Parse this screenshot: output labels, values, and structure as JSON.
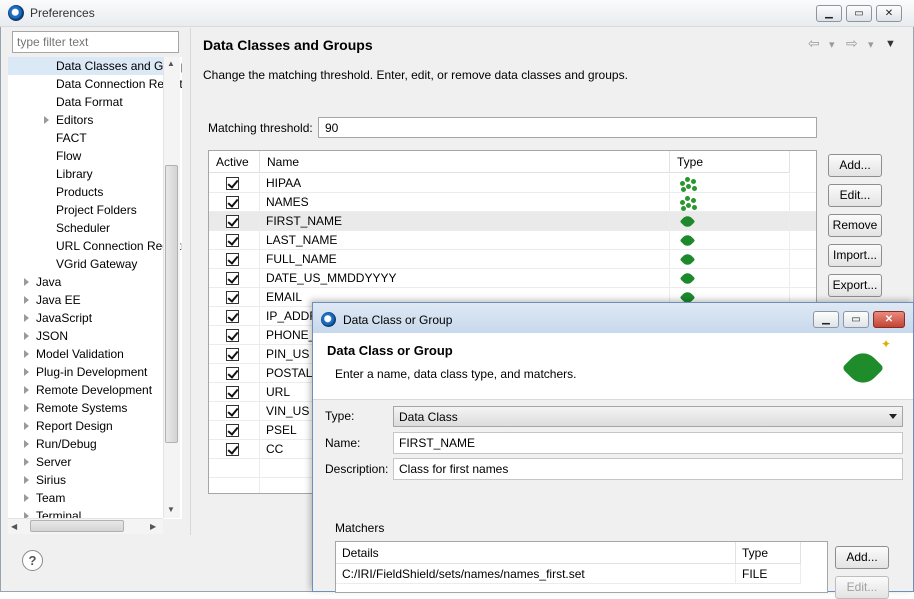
{
  "window": {
    "title": "Preferences",
    "controls": [
      "▁",
      "▭",
      "✕"
    ]
  },
  "filter": {
    "placeholder": "type filter text"
  },
  "tree": {
    "items": [
      {
        "label": "Data Classes and Groups",
        "selected": true,
        "twisty": ""
      },
      {
        "label": "Data Connection Registry",
        "twisty": ""
      },
      {
        "label": "Data Format",
        "twisty": ""
      },
      {
        "label": "Editors",
        "twisty": "hollow"
      },
      {
        "label": "FACT",
        "twisty": ""
      },
      {
        "label": "Flow",
        "twisty": ""
      },
      {
        "label": "Library",
        "twisty": ""
      },
      {
        "label": "Products",
        "twisty": ""
      },
      {
        "label": "Project Folders",
        "twisty": ""
      },
      {
        "label": "Scheduler",
        "twisty": ""
      },
      {
        "label": "URL Connection Registry",
        "twisty": ""
      },
      {
        "label": "VGrid Gateway",
        "twisty": ""
      },
      {
        "label": "Java",
        "twisty": "hollow",
        "top": true
      },
      {
        "label": "Java EE",
        "twisty": "hollow",
        "top": true
      },
      {
        "label": "JavaScript",
        "twisty": "hollow",
        "top": true
      },
      {
        "label": "JSON",
        "twisty": "hollow",
        "top": true
      },
      {
        "label": "Model Validation",
        "twisty": "hollow",
        "top": true
      },
      {
        "label": "Plug-in Development",
        "twisty": "hollow",
        "top": true
      },
      {
        "label": "Remote Development",
        "twisty": "hollow",
        "top": true
      },
      {
        "label": "Remote Systems",
        "twisty": "hollow",
        "top": true
      },
      {
        "label": "Report Design",
        "twisty": "hollow",
        "top": true
      },
      {
        "label": "Run/Debug",
        "twisty": "hollow",
        "top": true
      },
      {
        "label": "Server",
        "twisty": "hollow",
        "top": true
      },
      {
        "label": "Sirius",
        "twisty": "hollow",
        "top": true
      },
      {
        "label": "Team",
        "twisty": "hollow",
        "top": true
      },
      {
        "label": "Terminal",
        "twisty": "hollow",
        "top": true
      }
    ]
  },
  "help": {
    "label": "?"
  },
  "page": {
    "title": "Data Classes and Groups",
    "description": "Change the matching threshold. Enter, edit, or remove data classes and groups.",
    "threshold_label": "Matching threshold:",
    "threshold_value": "90",
    "nav": {
      "back": "⇦",
      "back_menu": "▾",
      "forward": "⇨",
      "forward_menu": "▾",
      "view_menu": "▼"
    }
  },
  "table": {
    "columns": [
      "Active",
      "Name",
      "Type"
    ],
    "rows": [
      {
        "name": "HIPAA",
        "type": "group",
        "active": true
      },
      {
        "name": "NAMES",
        "type": "group",
        "active": true
      },
      {
        "name": "FIRST_NAME",
        "type": "class",
        "active": true,
        "selected": true
      },
      {
        "name": "LAST_NAME",
        "type": "class",
        "active": true
      },
      {
        "name": "FULL_NAME",
        "type": "class",
        "active": true
      },
      {
        "name": "DATE_US_MMDDYYYY",
        "type": "class",
        "active": true
      },
      {
        "name": "EMAIL",
        "type": "class",
        "active": true
      },
      {
        "name": "IP_ADDRESS",
        "type": "class",
        "active": true
      },
      {
        "name": "PHONE_US",
        "type": "class",
        "active": true
      },
      {
        "name": "PIN_US",
        "type": "class",
        "active": true
      },
      {
        "name": "POSTAL_US",
        "type": "class",
        "active": true
      },
      {
        "name": "URL",
        "type": "class",
        "active": true
      },
      {
        "name": "VIN_US",
        "type": "class",
        "active": true
      },
      {
        "name": "PSEL",
        "type": "class",
        "active": true
      },
      {
        "name": "CC",
        "type": "class",
        "active": true
      }
    ]
  },
  "buttons": {
    "add": "Add...",
    "edit": "Edit...",
    "remove": "Remove",
    "import": "Import...",
    "export": "Export..."
  },
  "dialog": {
    "title": "Data Class or Group",
    "header_title": "Data Class or Group",
    "header_desc": "Enter a name, data class type, and matchers.",
    "type_label": "Type:",
    "type_value": "Data Class",
    "name_label": "Name:",
    "name_value": "FIRST_NAME",
    "desc_label": "Description:",
    "desc_value": "Class for first names",
    "matchers_label": "Matchers",
    "matchers_columns": [
      "Details",
      "Type"
    ],
    "matchers_rows": [
      {
        "details": "C:/IRI/FieldShield/sets/names/names_first.set",
        "type": "FILE"
      }
    ],
    "add_button": "Add...",
    "edit_button": "Edit..."
  }
}
